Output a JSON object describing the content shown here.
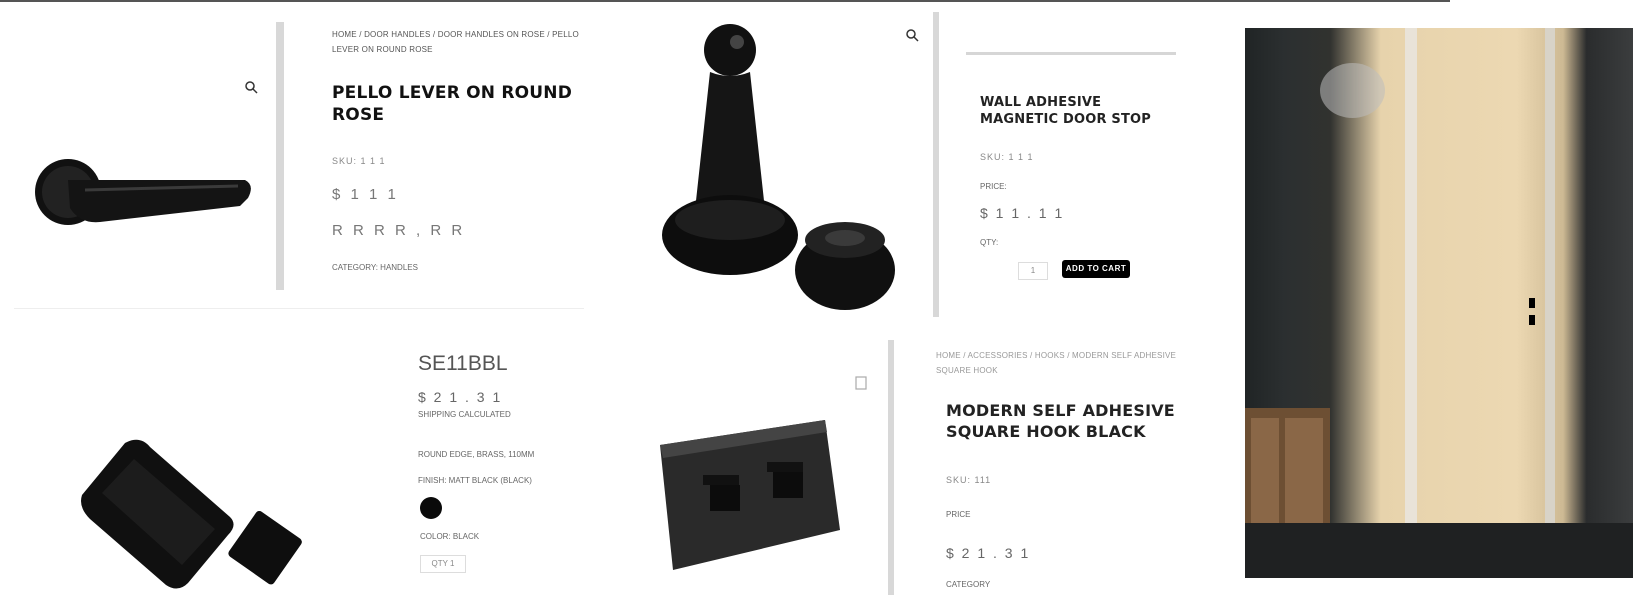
{
  "product_lever": {
    "breadcrumb": "HOME / DOOR HANDLES / DOOR HANDLES ON ROSE / PELLO LEVER ON ROUND ROSE",
    "title": "PELLO LEVER ON ROUND ROSE",
    "code_label": "SKU: 1 1 1",
    "price_line": "$ 1 1 1",
    "price_line2": "R R R R , R R",
    "category_label": "CATEGORY: HANDLES"
  },
  "product_doorstop": {
    "title": "WALL ADHESIVE MAGNETIC DOOR STOP",
    "sku": "SKU: 1 1 1",
    "price_label": "PRICE:",
    "price": "$ 1 1 . 1 1",
    "qty_label": "QTY:",
    "qty_value": "1",
    "cta": "ADD TO CART"
  },
  "product_bolt": {
    "sku": "SE11BBL",
    "price": "$ 2 1 . 3 1",
    "note": "SHIPPING CALCULATED",
    "option1": "ROUND EDGE, BRASS, 110MM",
    "option2": "FINISH: MATT BLACK (BLACK)",
    "color_label": "COLOR: BLACK",
    "qty_value": "QTY 1"
  },
  "product_hook": {
    "breadcrumb": "HOME / ACCESSORIES / HOOKS / MODERN SELF ADHESIVE SQUARE HOOK",
    "title": "MODERN SELF ADHESIVE SQUARE HOOK BLACK",
    "sku": "SKU: 111",
    "price_label": "PRICE",
    "price": "$ 2 1 . 3 1",
    "category_label": "CATEGORY"
  },
  "colors": {
    "accent": "#000000",
    "divider": "#d8d8d8"
  },
  "icons": [
    "search-icon",
    "search-icon",
    "search-icon"
  ]
}
